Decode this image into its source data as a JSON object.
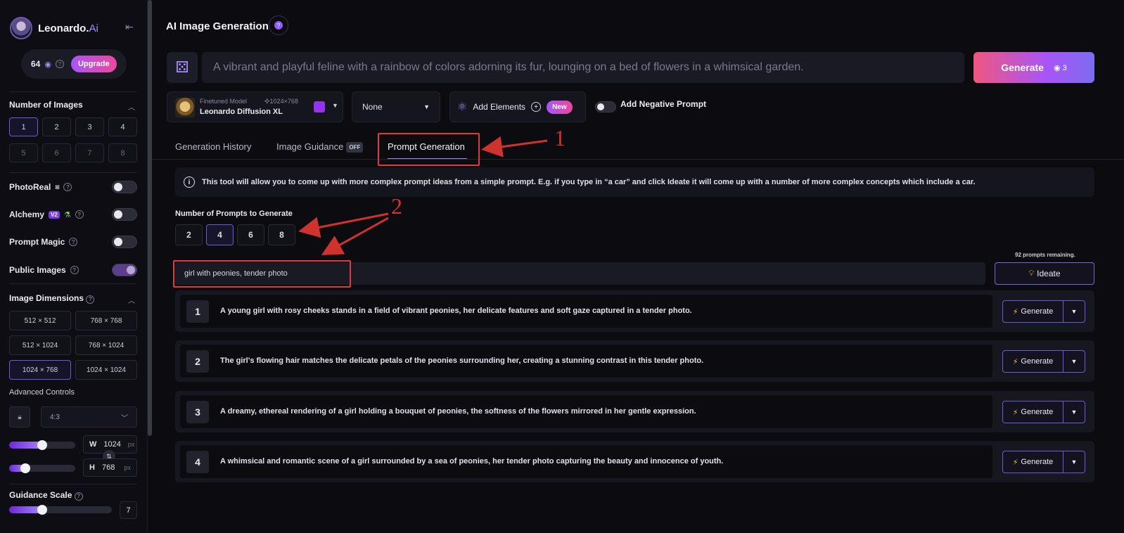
{
  "brand": {
    "name": "Leonardo.",
    "suffix": "Ai"
  },
  "tokens": {
    "count": "64",
    "upgrade_label": "Upgrade"
  },
  "sidebar": {
    "num_images_title": "Number of Images",
    "num_images": [
      "1",
      "2",
      "3",
      "4",
      "5",
      "6",
      "7",
      "8"
    ],
    "num_images_selected": "1",
    "photoreal_label": "PhotoReal",
    "alchemy_label": "Alchemy",
    "alchemy_badge": "V2",
    "prompt_magic_label": "Prompt Magic",
    "public_images_label": "Public Images",
    "image_dimensions_title": "Image Dimensions",
    "dimensions": [
      "512 × 512",
      "768 × 768",
      "512 × 1024",
      "768 × 1024",
      "1024 × 768",
      "1024 × 1024"
    ],
    "dimension_selected": "1024 × 768",
    "advanced_controls_label": "Advanced Controls",
    "aspect_ratio": "4:3",
    "width": {
      "label": "W",
      "value": "1024",
      "unit": "px"
    },
    "height": {
      "label": "H",
      "value": "768",
      "unit": "px"
    },
    "guidance_scale_title": "Guidance Scale",
    "guidance_scale_value": "7"
  },
  "header": {
    "title": "AI Image Generation"
  },
  "prompt": {
    "text": "A vibrant and playful feline with a rainbow of colors adorning its fur, lounging on a bed of flowers in a whimsical garden.",
    "generate_label": "Generate",
    "generate_cost": "3"
  },
  "model": {
    "type": "Finetuned Model",
    "resolution": "1024×768",
    "name": "Leonardo Diffusion XL"
  },
  "style_select": "None",
  "elements": {
    "label": "Add Elements",
    "badge": "New"
  },
  "negative_prompt_label": "Add Negative Prompt",
  "tabs": [
    {
      "label": "Generation History"
    },
    {
      "label": "Image Guidance",
      "badge": "OFF"
    },
    {
      "label": "Prompt Generation"
    }
  ],
  "info_text": "This tool will allow you to come up with more complex prompt ideas from a simple prompt. E.g. if you type in “a car” and click Ideate it will come up with a number of more complex concepts which include a car.",
  "prompt_generation": {
    "count_label": "Number of Prompts to Generate",
    "counts": [
      "2",
      "4",
      "6",
      "8"
    ],
    "count_selected": "4",
    "remaining": "92 prompts remaining.",
    "idea_input": "girl with peonies, tender photo",
    "ideate_label": "Ideate",
    "results": [
      {
        "num": "1",
        "text": "A young girl with rosy cheeks stands in a field of vibrant peonies, her delicate features and soft gaze captured in a tender photo."
      },
      {
        "num": "2",
        "text": "The girl's flowing hair matches the delicate petals of the peonies surrounding her, creating a stunning contrast in this tender photo."
      },
      {
        "num": "3",
        "text": "A dreamy, ethereal rendering of a girl holding a bouquet of peonies, the softness of the flowers mirrored in her gentle expression."
      },
      {
        "num": "4",
        "text": "A whimsical and romantic scene of a girl surrounded by a sea of peonies, her tender photo capturing the beauty and innocence of youth."
      }
    ],
    "result_generate_label": "Generate"
  },
  "annotations": [
    "1",
    "2"
  ],
  "colors": {
    "accent": "#7c6cf0",
    "brand_pink": "#f0567f",
    "annotation_red": "#e03a3a"
  }
}
